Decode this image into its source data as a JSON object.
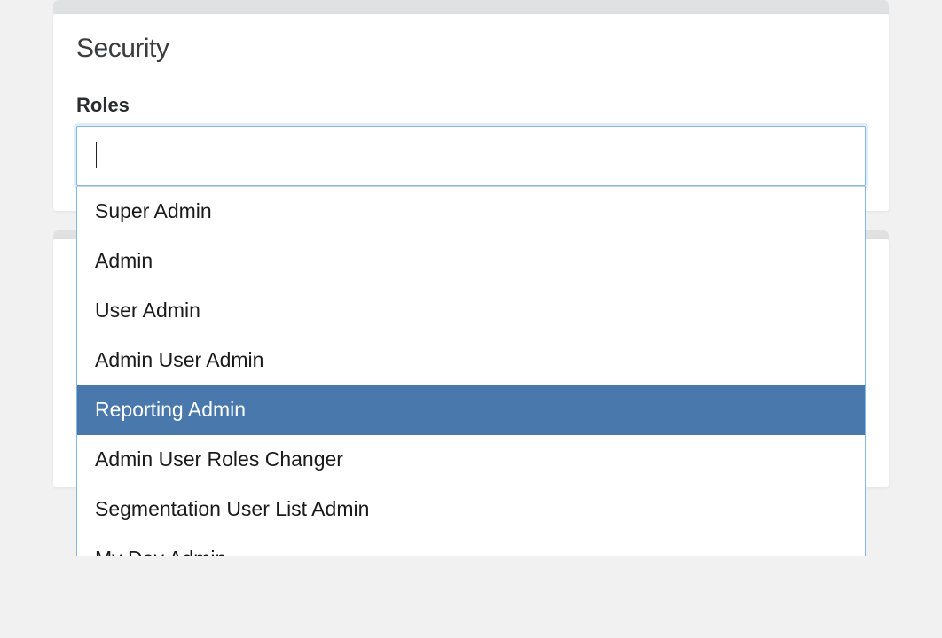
{
  "card": {
    "title": "Security",
    "roles_label": "Roles",
    "roles_value": "",
    "roles_placeholder": ""
  },
  "dropdown": {
    "highlighted_index": 4,
    "options": [
      "Super Admin",
      "Admin",
      "User Admin",
      "Admin User Admin",
      "Reporting Admin",
      "Admin User Roles Changer",
      "Segmentation User List Admin",
      "My Day Admin"
    ]
  },
  "colors": {
    "highlight_bg": "#4878ac",
    "focus_border": "#85b7e8"
  }
}
